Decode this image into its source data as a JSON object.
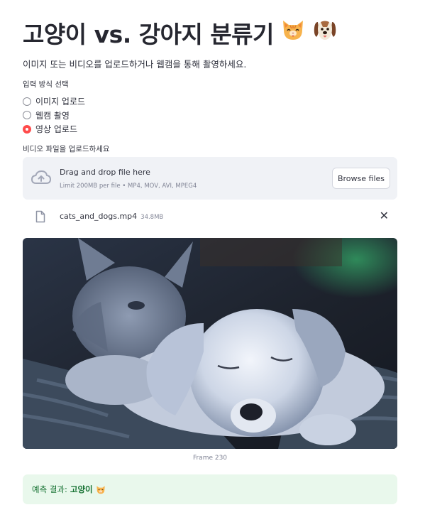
{
  "header": {
    "title": "고양이 vs. 강아지 분류기",
    "title_icons": [
      "cat-face-emoji",
      "dog-face-emoji"
    ]
  },
  "description": "이미지 또는 비디오를 업로드하거나 웹캠을 통해 촬영하세요.",
  "input_mode": {
    "label": "입력 방식 선택",
    "options": [
      {
        "label": "이미지 업로드",
        "selected": false
      },
      {
        "label": "웹캠 촬영",
        "selected": false
      },
      {
        "label": "영상 업로드",
        "selected": true
      }
    ]
  },
  "uploader": {
    "label": "비디오 파일을 업로드하세요",
    "drop_text": "Drag and drop file here",
    "limit_text": "Limit 200MB per file • MP4, MOV, AVI, MPEG4",
    "browse_label": "Browse files",
    "icon": "cloud-upload-icon"
  },
  "uploaded_file": {
    "name": "cats_and_dogs.mp4",
    "size": "34.8MB",
    "icon": "file-icon",
    "remove_icon": "close-icon"
  },
  "video_frame": {
    "caption": "Frame 230",
    "subject": "kitten-and-puppy-in-basket"
  },
  "result": {
    "prefix": "예측 결과:",
    "value": "고양이",
    "icon": "cat-face-emoji"
  },
  "colors": {
    "accent": "#ff4b4b",
    "dropzone_bg": "#f0f2f6",
    "success_bg": "#e9f8ec",
    "success_text": "#177233",
    "text": "#31333f",
    "muted": "#808495"
  }
}
